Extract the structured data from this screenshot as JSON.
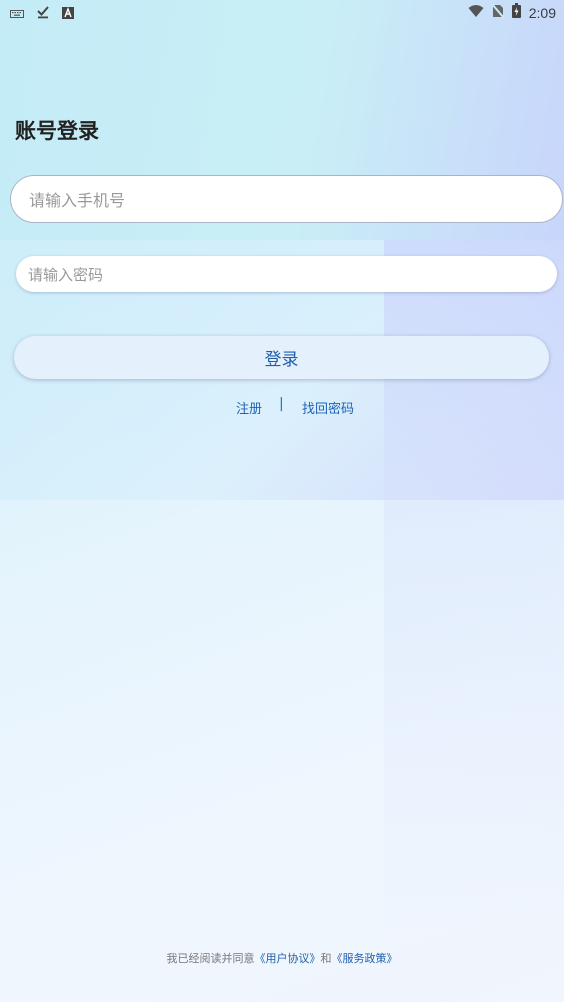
{
  "status_bar": {
    "left_icons": [
      "keyboard-icon",
      "check-download-icon",
      "a-box-icon"
    ],
    "right_icons": [
      "wifi-icon",
      "no-sim-icon",
      "battery-icon"
    ],
    "time": "2:09"
  },
  "title": "账号登录",
  "phone_input": {
    "placeholder": "请输入手机号"
  },
  "password_input": {
    "placeholder": "请输入密码"
  },
  "login_button": "登录",
  "links": {
    "register": "注册",
    "separator": "|",
    "forgot_password": "找回密码"
  },
  "agreement": {
    "prefix": "我已经阅读并同意",
    "user_agreement": "《用户协议》",
    "connector": "和",
    "service_policy": "《服务政策》"
  },
  "colors": {
    "accent": "#1f5fae",
    "title": "#222222",
    "placeholder": "#999999"
  }
}
